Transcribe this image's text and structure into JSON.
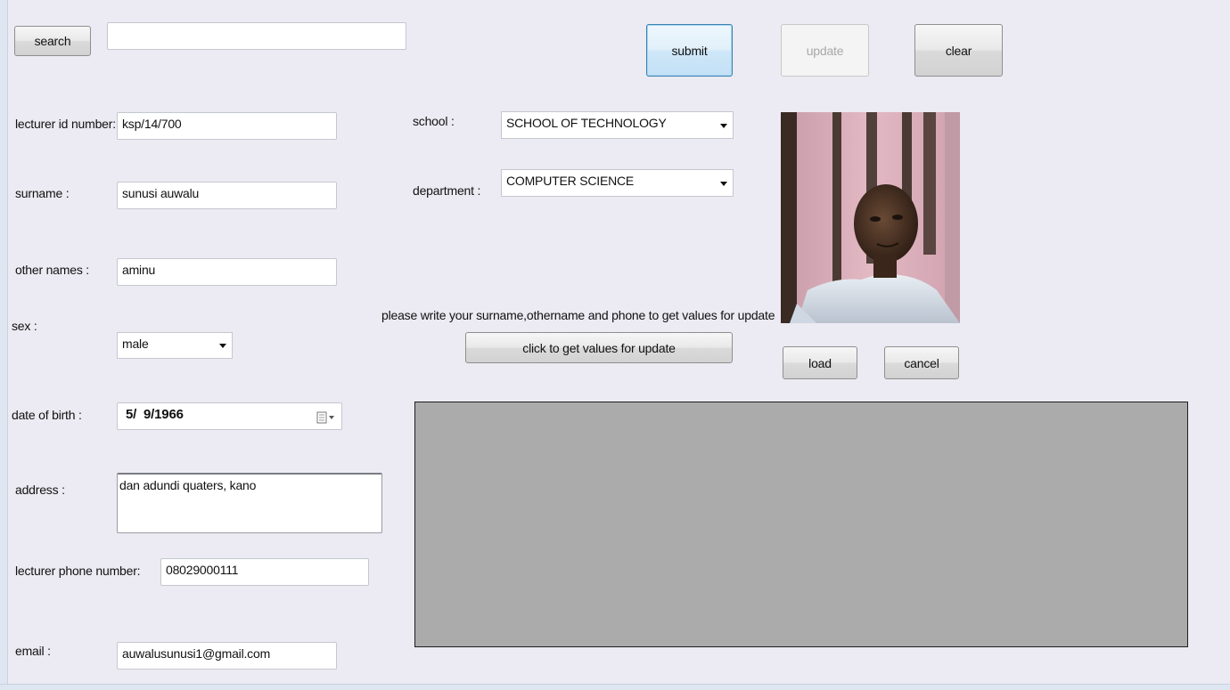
{
  "toolbar": {
    "search_label": "search",
    "search_value": "",
    "submit_label": "submit",
    "update_label": "update",
    "clear_label": "clear"
  },
  "form": {
    "lecturer_id": {
      "label": "lecturer id number:",
      "value": "ksp/14/700"
    },
    "surname": {
      "label": "surname :",
      "value": "sunusi auwalu"
    },
    "other_names": {
      "label": "other names :",
      "value": "aminu"
    },
    "sex": {
      "label": "sex :",
      "value": "male"
    },
    "dob": {
      "label": "date of birth :",
      "value": "5/  9/1966"
    },
    "address": {
      "label": "address :",
      "value": "dan adundi quaters, kano"
    },
    "phone": {
      "label": "lecturer phone number:",
      "value": "08029000111"
    },
    "email": {
      "label": "email :",
      "value": "auwalusunusi1@gmail.com"
    },
    "school": {
      "label": "school :",
      "value": "SCHOOL OF TECHNOLOGY"
    },
    "department": {
      "label": "department :",
      "value": "COMPUTER SCIENCE"
    }
  },
  "update_hint": "please write your surname,othername and phone to get values for update",
  "get_values_label": "click to get values for update",
  "photo": {
    "load_label": "load",
    "cancel_label": "cancel"
  },
  "colors": {
    "background": "#eceaf2",
    "grid_panel": "#ababab",
    "focus_border": "#3c7fb1"
  }
}
